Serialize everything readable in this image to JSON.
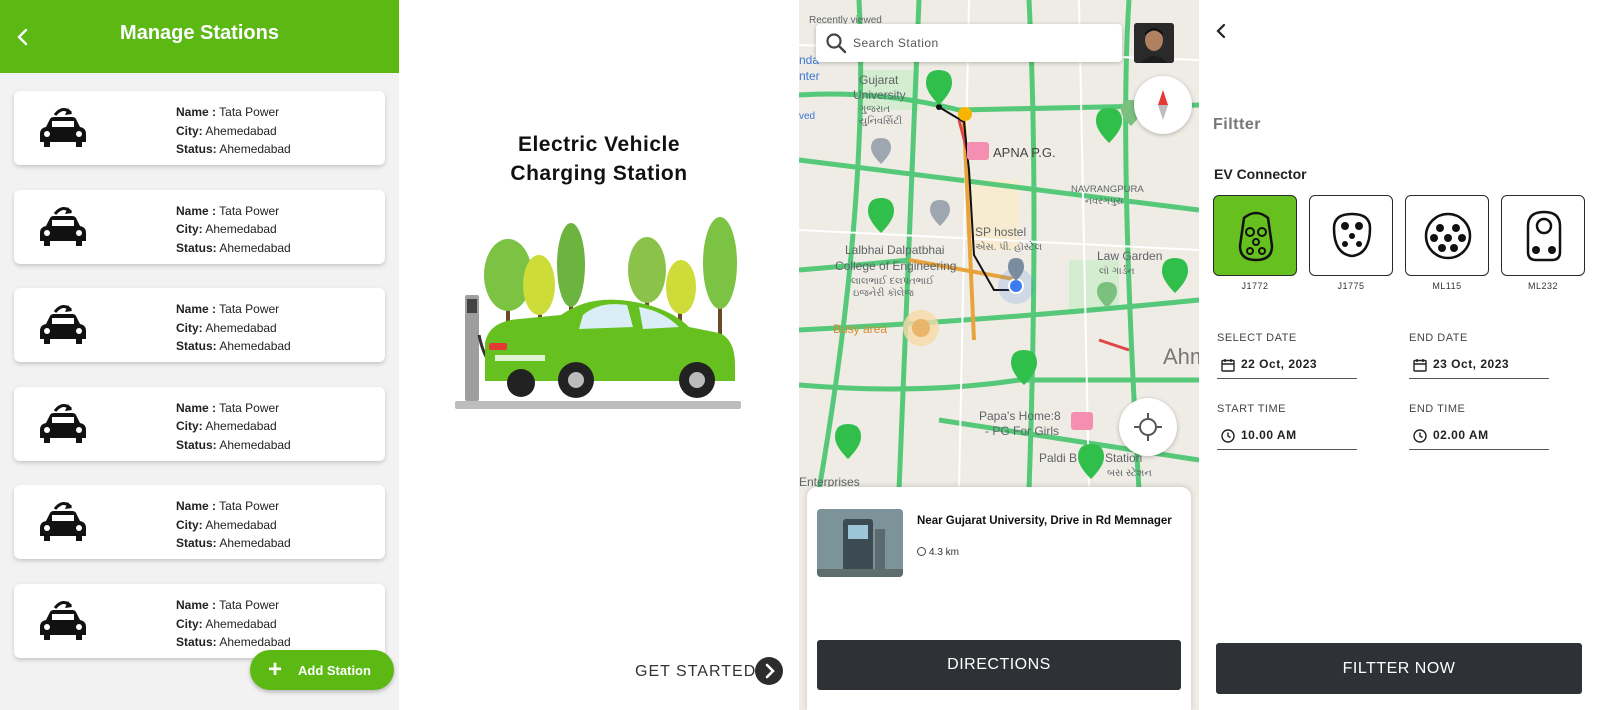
{
  "manage": {
    "title": "Manage Stations",
    "field_labels": {
      "name": "Name :",
      "city": "City:",
      "status": "Status:"
    },
    "stations": [
      {
        "name": "Tata Power",
        "city": "Ahemedabad",
        "status": "Ahemedabad"
      },
      {
        "name": "Tata Power",
        "city": "Ahemedabad",
        "status": "Ahemedabad"
      },
      {
        "name": "Tata Power",
        "city": "Ahemedabad",
        "status": "Ahemedabad"
      },
      {
        "name": "Tata Power",
        "city": "Ahemedabad",
        "status": "Ahemedabad"
      },
      {
        "name": "Tata Power",
        "city": "Ahemedabad",
        "status": "Ahemedabad"
      },
      {
        "name": "Tata Power",
        "city": "Ahemedabad",
        "status": "Ahemedabad"
      }
    ],
    "add_button": "Add Station",
    "icons": {
      "back": "back-arrow-icon",
      "station": "ev-car-charging-icon",
      "add": "plus-icon"
    },
    "accent": "#5cb914"
  },
  "onboarding": {
    "title_line1": "Electric Vehicle",
    "title_line2": "Charging Station",
    "cta": "GET STARTED",
    "icons": {
      "cta": "chevron-right-icon"
    }
  },
  "map": {
    "search_placeholder": "Search Station",
    "labels": {
      "recently_viewed": "Recently viewed",
      "gujarat": "Gujarat",
      "university": "University",
      "gujarat_gu": "ગુજરાત",
      "university_gu": "યુનિવર્સિટી",
      "apna": "APNA P.G.",
      "navrangpura": "NAVRANGPURA",
      "navrangpura_gu": "નવરંગપુરા",
      "sp_hostel": "SP hostel",
      "sp_hostel_gu": "એસ. પી. હૉસ્ટેલ",
      "lalbhai1": "Lalbhai Dalpatbhai",
      "lalbhai2": "College of Engineering",
      "lalbhai_gu1": "લાલભાઈ દલપતભાઈ",
      "lalbhai_gu2": "ઇજનેરી કૉલેજ",
      "law_garden": "Law Garden",
      "law_garden_gu": "લૉ ગાર્ડન",
      "busy_area": "Busy area",
      "papas1": "Papa's Home:8",
      "papas2": "- PG For Girls",
      "paldi": "Paldi B",
      "station": "Station",
      "station_gu": "બસ સ્ટેશન",
      "enterprises": "Enterprises",
      "ahm": "Ahm",
      "nter": "nter",
      "nda": "nda",
      "ved": "ved"
    },
    "place": {
      "name": "Near Gujarat University, Drive in Rd Memnager",
      "distance": "4.3 km"
    },
    "directions_button": "DIRECTIONS",
    "icons": {
      "search": "search-icon",
      "compass": "compass-icon",
      "locate": "my-location-icon",
      "marker": "charging-marker-icon"
    }
  },
  "filter": {
    "title": "Filtter",
    "section": "EV Connector",
    "connectors": [
      {
        "label": "J1772",
        "selected": true
      },
      {
        "label": "J1775",
        "selected": false
      },
      {
        "label": "ML115",
        "selected": false
      },
      {
        "label": "ML232",
        "selected": false
      }
    ],
    "select_date_label": "SELECT DATE",
    "select_date_value": "22 Oct, 2023",
    "end_date_label": "END DATE",
    "end_date_value": "23 Oct, 2023",
    "start_time_label": "START TIME",
    "start_time_value": "10.00 AM",
    "end_time_label": "END TIME",
    "end_time_value": "02.00 AM",
    "button": "FILTTER NOW",
    "icons": {
      "back": "back-arrow-icon",
      "date": "calendar-icon",
      "time": "clock-icon"
    }
  }
}
